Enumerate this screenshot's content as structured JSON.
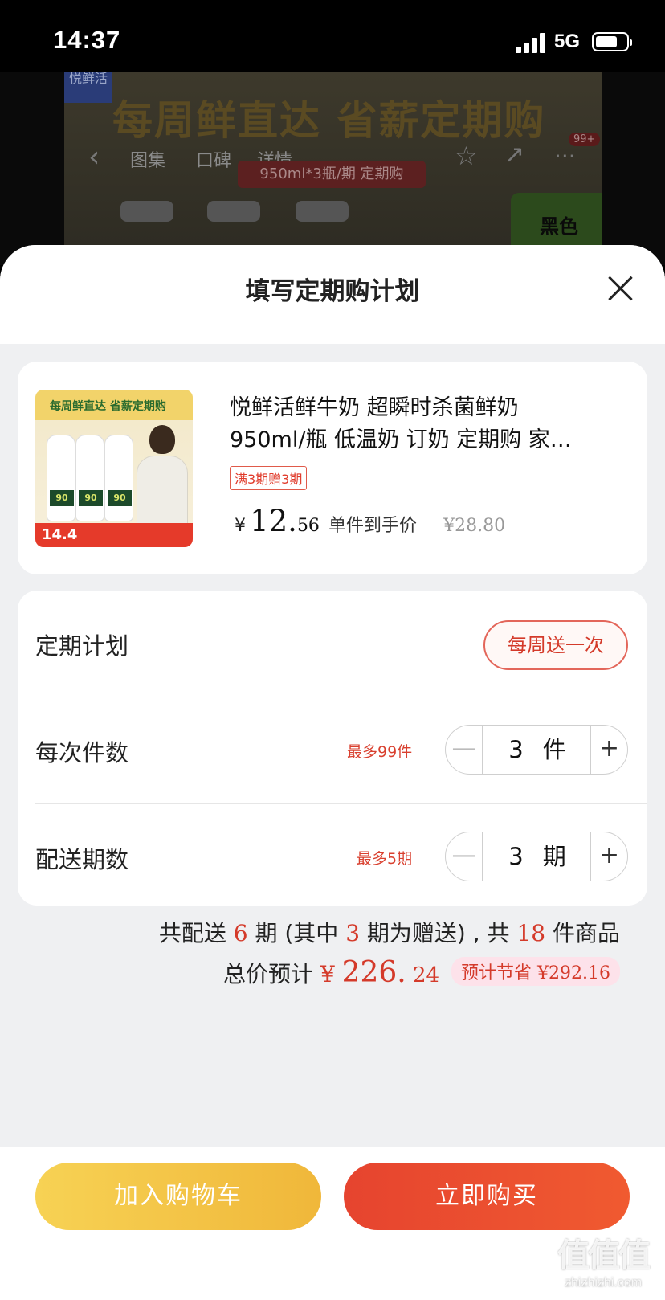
{
  "status_bar": {
    "time": "14:37",
    "network": "5G"
  },
  "background_page": {
    "brand_tag": "悦鲜活",
    "headline": "每周鲜直达 省薪定期购",
    "tabs": [
      "图集",
      "口碑",
      "详情"
    ],
    "spec_pill": "950ml*3瓶/期 定期购",
    "badge": "99+",
    "promo_corner": "黑色"
  },
  "sheet": {
    "title": "填写定期购计划"
  },
  "product": {
    "thumbnail": {
      "headline": "每周鲜直达 省薪定期购",
      "price_corner": "14.4"
    },
    "title_line1": "悦鲜活鲜牛奶 超瞬时杀菌鲜奶",
    "title_line2": "950ml/瓶 低温奶 订奶 定期购 家…",
    "promo_tag": "满3期赠3期",
    "currency": "¥",
    "price_int": "12.",
    "price_dec": "56",
    "price_note": "单件到手价",
    "original_price": "¥28.80"
  },
  "plan": {
    "frequency_label": "定期计划",
    "frequency_value": "每周送一次",
    "quantity_label": "每次件数",
    "quantity_hint": "最多99件",
    "quantity_value": "3",
    "quantity_unit": "件",
    "periods_label": "配送期数",
    "periods_hint": "最多5期",
    "periods_value": "3",
    "periods_unit": "期",
    "minus": "—",
    "plus": "+"
  },
  "summary": {
    "p1": "共配送 ",
    "total_periods": "6",
    "p2": " 期 (其中 ",
    "gift_periods": "3",
    "p3": " 期为赠送) , 共 ",
    "total_items": "18",
    "p4": " 件商品",
    "total_label": "总价预计 ",
    "total_currency": "¥ ",
    "total_int": "226.",
    "total_dec": " 24",
    "savings_label": "预计节省 ",
    "savings_value": "¥292.16"
  },
  "actions": {
    "add_to_cart": "加入购物车",
    "buy_now": "立即购买"
  },
  "watermark": {
    "logo": "值值值",
    "url": "zhizhizhi.com"
  }
}
